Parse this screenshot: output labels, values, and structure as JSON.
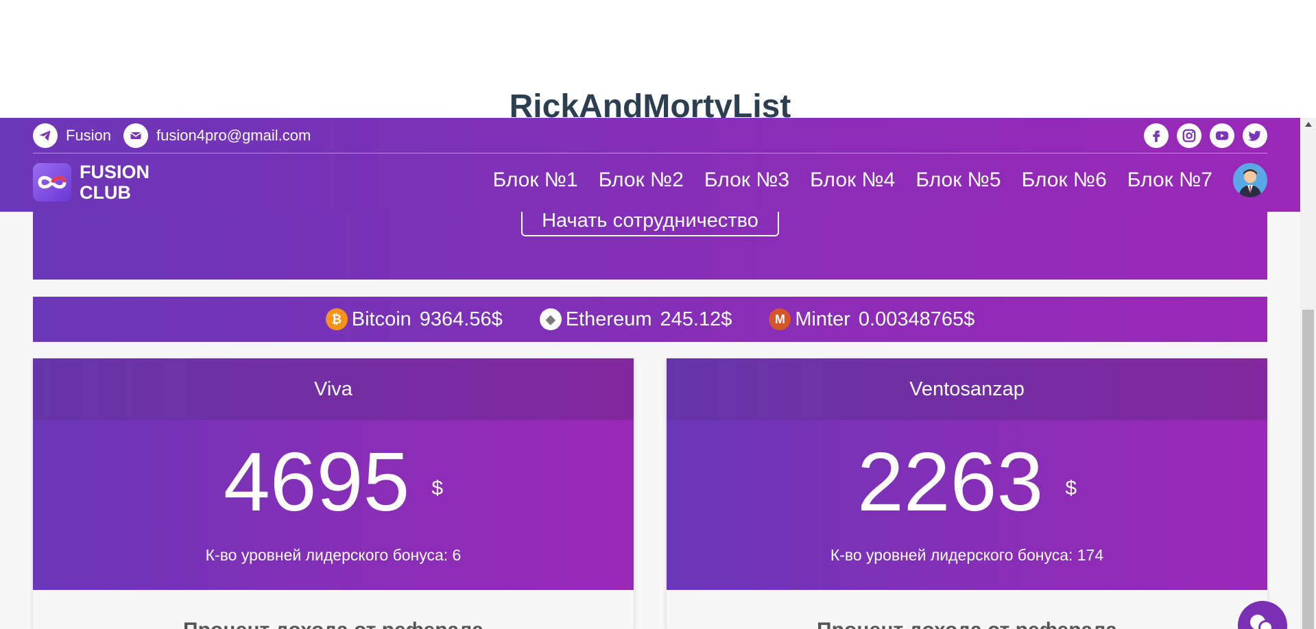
{
  "page": {
    "heading": "RickAndMortyList"
  },
  "header": {
    "telegram_label": "Fusion",
    "email_label": "fusion4pro@gmail.com",
    "socials": [
      "facebook-icon",
      "instagram-icon",
      "youtube-icon",
      "twitter-icon"
    ],
    "logo_line1": "FUSION",
    "logo_line2": "CLUB",
    "nav": [
      "Блок №1",
      "Блок №2",
      "Блок №3",
      "Блок №4",
      "Блок №5",
      "Блок №6",
      "Блок №7"
    ]
  },
  "hero": {
    "cta_label": "Начать сотрудничество"
  },
  "ticker": [
    {
      "name": "Bitcoin",
      "price": "9364.56$",
      "icon": "bitcoin-icon",
      "color": "#f7931a",
      "glyph": "₿"
    },
    {
      "name": "Ethereum",
      "price": "245.12$",
      "icon": "ethereum-icon",
      "color": "#ffffff",
      "glyph": "◆"
    },
    {
      "name": "Minter",
      "price": "0.00348765$",
      "icon": "minter-icon",
      "color": "#d2562a",
      "glyph": "M"
    }
  ],
  "cards": [
    {
      "title": "Viva",
      "amount": "4695",
      "currency": "$",
      "levels": "К-во уровней лидерского бонуса: 6",
      "footer": "Процент дохода от реферала"
    },
    {
      "title": "Ventosanzap",
      "amount": "2263",
      "currency": "$",
      "levels": "К-во уровней лидерского бонуса: 174",
      "footer": "Процент дохода от реферала"
    }
  ],
  "colors": {
    "brand_start": "#6a37b7",
    "brand_end": "#9a28b7"
  }
}
